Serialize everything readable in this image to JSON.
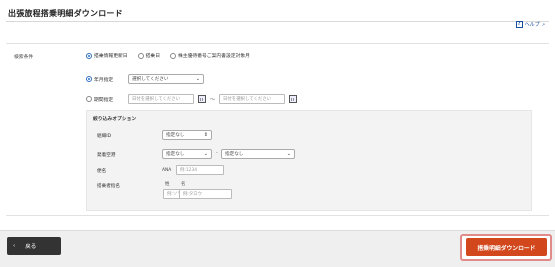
{
  "page": {
    "title": "出張旅程搭乗明細ダウンロード",
    "help_label": "ヘルプ",
    "help_icon": "question-icon"
  },
  "search": {
    "section_label": "検索条件",
    "date_types": [
      {
        "label": "搭乗情報更新日",
        "selected": true
      },
      {
        "label": "搭乗日",
        "selected": false
      },
      {
        "label": "株主優待番号ご案内書設定対象月",
        "selected": false
      }
    ],
    "year_month": {
      "label": "年月指定",
      "selected": true,
      "value": "選択してください"
    },
    "period": {
      "label": "期間指定",
      "selected": false,
      "from_placeholder": "日付を選択してください",
      "to_placeholder": "日付を選択してください",
      "separator": "〜"
    }
  },
  "filter": {
    "title": "絞り込みオプション",
    "org": {
      "label": "組織ID",
      "value": "指定なし"
    },
    "route": {
      "label": "発着空港",
      "from_value": "指定なし",
      "to_value": "指定なし",
      "separator": "-"
    },
    "flight": {
      "label": "便名",
      "prefix": "ANA",
      "placeholder": "例:1234"
    },
    "passenger": {
      "label": "搭乗者指名",
      "last_label": "姓",
      "first_label": "名",
      "last_placeholder": "例:ソラノ",
      "first_placeholder": "例:タロウ"
    }
  },
  "actions": {
    "back_label": "戻る",
    "download_label": "搭乗明細ダウンロード",
    "download_color": "#d2481c"
  }
}
